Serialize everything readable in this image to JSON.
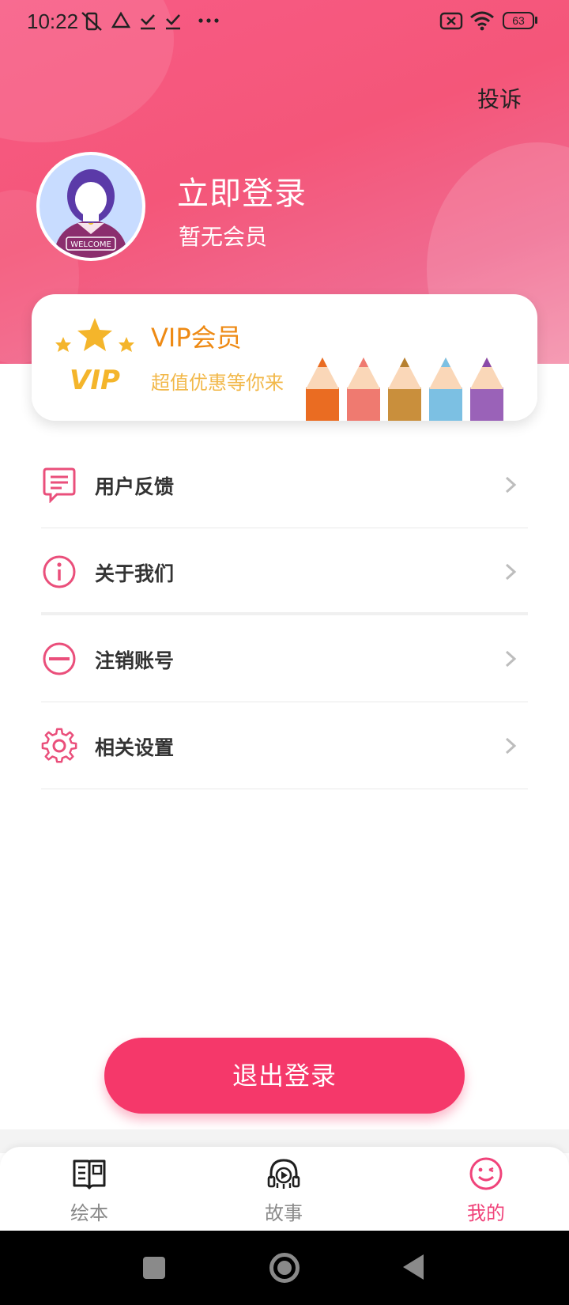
{
  "status_bar": {
    "time": "10:22",
    "battery": "63"
  },
  "header": {
    "complaint_label": "投诉",
    "login_title": "立即登录",
    "member_status": "暂无会员",
    "avatar_text": "WELCOME"
  },
  "vip": {
    "badge_text": "VIP",
    "title": "VIP会员",
    "subtitle": "超值优惠等你来"
  },
  "menu": {
    "items": [
      {
        "label": "用户反馈",
        "icon": "feedback-icon"
      },
      {
        "label": "关于我们",
        "icon": "info-icon"
      },
      {
        "label": "注销账号",
        "icon": "minus-circle-icon"
      },
      {
        "label": "相关设置",
        "icon": "gear-icon"
      }
    ]
  },
  "logout_label": "退出登录",
  "tabs": [
    {
      "label": "绘本",
      "icon": "book-icon",
      "active": false
    },
    {
      "label": "故事",
      "icon": "headphones-icon",
      "active": false
    },
    {
      "label": "我的",
      "icon": "smiley-icon",
      "active": true
    }
  ],
  "colors": {
    "accent": "#f5386a",
    "header": "#f45679",
    "vip_orange": "#ee8a14"
  }
}
